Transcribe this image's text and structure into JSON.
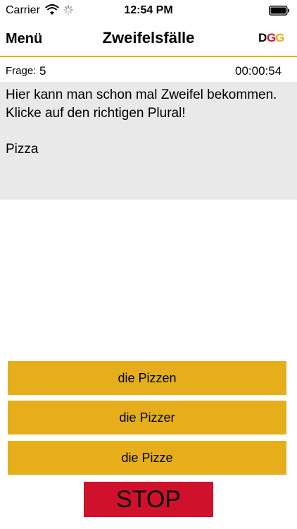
{
  "status_bar": {
    "carrier": "Carrier",
    "time": "12:54 PM"
  },
  "nav": {
    "menu_label": "Menü",
    "title": "Zweifelsfälle",
    "logo_text": "DGG"
  },
  "quiz": {
    "question_label": "Frage:",
    "question_number": "5",
    "timer": "00:00:54",
    "question_text": "Hier kann man schon mal Zweifel bekommen.\nKlicke auf den richtigen Plural!\n\nPizza",
    "answers": [
      "die Pizzen",
      "die Pizzer",
      "die Pizze"
    ],
    "stop_label": "STOP"
  },
  "colors": {
    "accent": "#E5AE1A",
    "stop": "#D0112B",
    "question_bg": "#E9E9E9",
    "nav_divider": "#E5AE1A"
  }
}
